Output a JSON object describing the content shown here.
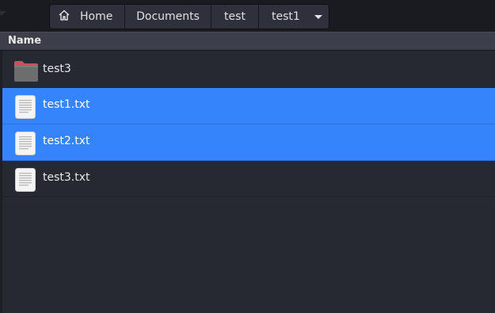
{
  "pathbar": {
    "crumbs": [
      {
        "label": "Home",
        "icon": "home-icon"
      },
      {
        "label": "Documents"
      },
      {
        "label": "test"
      },
      {
        "label": "test1",
        "dropdown": "chevron-down-icon"
      }
    ]
  },
  "columns": {
    "name_header": "Name"
  },
  "files": [
    {
      "name": "test3",
      "type": "folder",
      "icon": "folder-icon",
      "selected": false
    },
    {
      "name": "test1.txt",
      "type": "text",
      "icon": "text-file-icon",
      "selected": true
    },
    {
      "name": "test2.txt",
      "type": "text",
      "icon": "text-file-icon",
      "selected": true
    },
    {
      "name": "test3.txt",
      "type": "text",
      "icon": "text-file-icon",
      "selected": false
    }
  ],
  "colors": {
    "background": "#262932",
    "selection": "#3584fb",
    "header": "#3c3f4a",
    "pathbar": "#2e313b",
    "folder_tab": "#c9505f"
  }
}
